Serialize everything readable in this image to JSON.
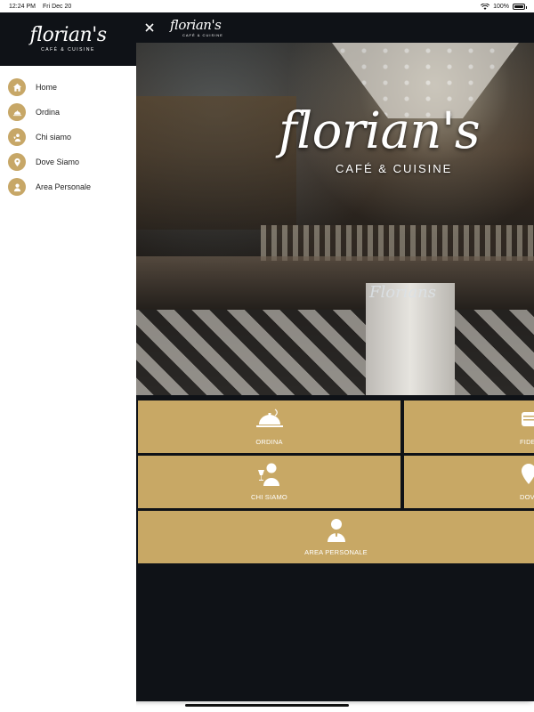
{
  "status_bar": {
    "time": "12:24 PM",
    "date": "Fri Dec 20",
    "battery": "100%",
    "battery_level": 1.0
  },
  "brand": {
    "name": "florian's",
    "subtitle": "CAFÉ & CUISINE",
    "accent_color": "#c7a767",
    "dark_color": "#0f1217"
  },
  "drawer": {
    "items": [
      {
        "label": "Home",
        "icon": "home-icon"
      },
      {
        "label": "Ordina",
        "icon": "cloche-icon"
      },
      {
        "label": "Chi siamo",
        "icon": "waiter-icon"
      },
      {
        "label": "Dove Siamo",
        "icon": "location-pin-icon"
      },
      {
        "label": "Area Personale",
        "icon": "user-icon"
      }
    ]
  },
  "hero": {
    "script": "florian's",
    "subtitle": "CAFÉ & CUISINE",
    "pillar_text": "Florians"
  },
  "tiles": {
    "ordina": "ORDINA",
    "fidelity": "FIDE",
    "chi_siamo": "CHI SIAMO",
    "dove": "DOVE",
    "area_personale": "AREA PERSONALE"
  }
}
